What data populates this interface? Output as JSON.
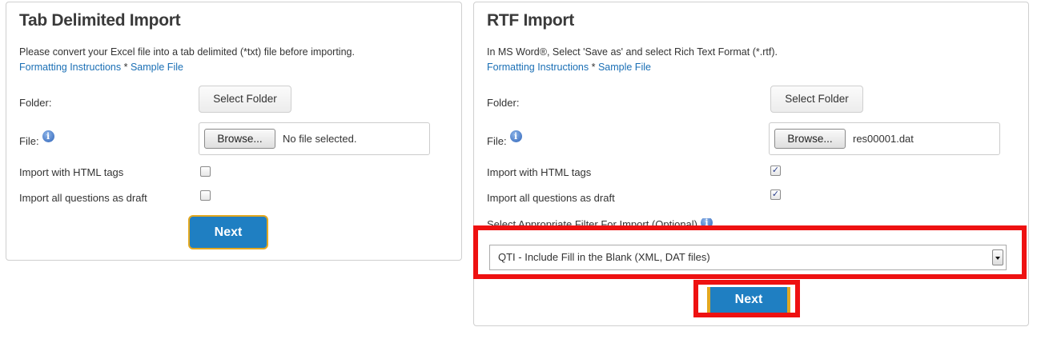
{
  "tab_import": {
    "title": "Tab Delimited Import",
    "description": "Please convert your Excel file into a tab delimited (*txt) file before importing.",
    "formatting_link": "Formatting Instructions",
    "separator": " * ",
    "sample_link": "Sample File",
    "folder_label": "Folder:",
    "select_folder": "Select Folder",
    "file_label": "File:",
    "browse": "Browse...",
    "file_status": "No file selected.",
    "html_tags_label": "Import with HTML tags",
    "html_tags_checked": false,
    "draft_label": "Import all questions as draft",
    "draft_checked": false,
    "next": "Next"
  },
  "rtf_import": {
    "title": "RTF Import",
    "description": "In MS Word®, Select 'Save as' and select Rich Text Format (*.rtf).",
    "formatting_link": "Formatting Instructions",
    "separator": " * ",
    "sample_link": "Sample File",
    "folder_label": "Folder:",
    "select_folder": "Select Folder",
    "file_label": "File:",
    "browse": "Browse...",
    "file_status": "res00001.dat",
    "html_tags_label": "Import with HTML tags",
    "html_tags_checked": true,
    "draft_label": "Import all questions as draft",
    "draft_checked": true,
    "filter_label": "Select Appropriate Filter For Import (Optional)",
    "filter_value": "QTI - Include Fill in the Blank (XML, DAT files)",
    "next": "Next"
  },
  "icons": {
    "info": "info-icon",
    "check": "✓",
    "info_glyph": "i"
  },
  "colors": {
    "link": "#1a6fb5",
    "next_bg": "#1f7fc2",
    "next_border": "#e3a820",
    "highlight": "#ee1111"
  }
}
